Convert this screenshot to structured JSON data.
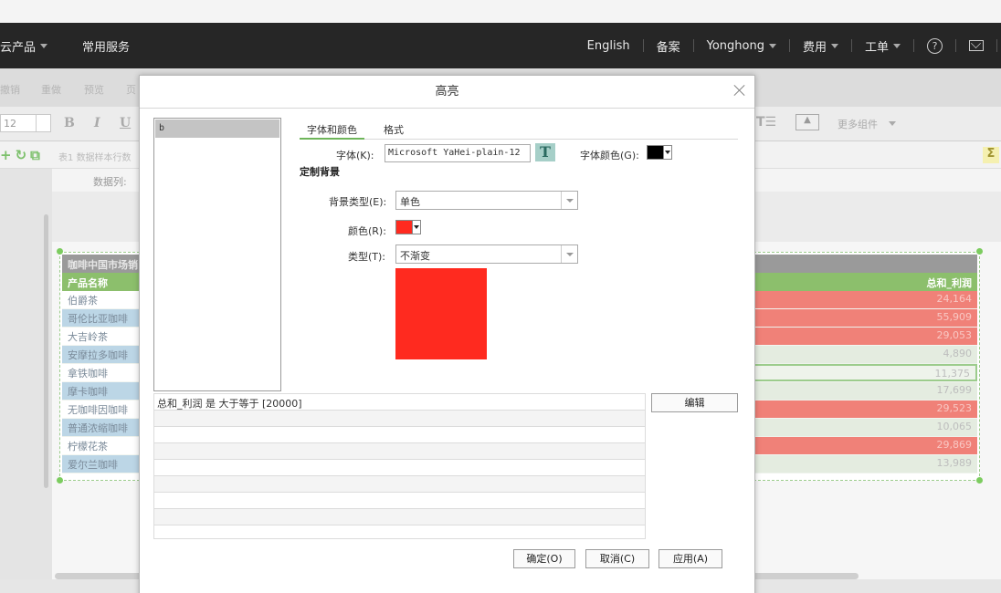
{
  "topnav": {
    "left_items": [
      "云产品",
      "常用服务"
    ],
    "right_items": [
      "English",
      "备案",
      "Yonghong",
      "费用",
      "工单"
    ],
    "help_icon": "question-circle-icon",
    "mail_icon": "mail-icon"
  },
  "editor": {
    "toolbar1": [
      "撤销",
      "重做",
      "预览",
      "页"
    ],
    "font_size": "12",
    "toolbar2_tools": [
      "B",
      "I",
      "U"
    ],
    "more_components": "更多组件",
    "sheet_label": "表1",
    "sheet_hint": "数据样本行数",
    "data_column_label": "数据列:",
    "sigma": "Σ"
  },
  "bg_table": {
    "title": "咖啡中国市场销",
    "col_name": "产品名称",
    "col_value": "总和_利润",
    "rows": [
      {
        "name": "伯爵茶",
        "value": "24,164",
        "hl": true
      },
      {
        "name": "哥伦比亚咖啡",
        "value": "55,909",
        "hl": true
      },
      {
        "name": "大吉岭茶",
        "value": "29,053",
        "hl": true
      },
      {
        "name": "安摩拉多咖啡",
        "value": "4,890",
        "hl": false
      },
      {
        "name": "拿铁咖啡",
        "value": "11,375",
        "hl": false
      },
      {
        "name": "摩卡咖啡",
        "value": "17,699",
        "hl": false
      },
      {
        "name": "无咖啡因咖啡",
        "value": "29,523",
        "hl": true
      },
      {
        "name": "普通浓缩咖啡",
        "value": "10,065",
        "hl": false
      },
      {
        "name": "柠檬花茶",
        "value": "29,869",
        "hl": true
      },
      {
        "name": "爱尔兰咖啡",
        "value": "13,989",
        "hl": false
      }
    ]
  },
  "dialog": {
    "title": "高亮",
    "rule_items": [
      "b"
    ],
    "tabs": [
      "字体和颜色",
      "格式"
    ],
    "font_label": "字体(K):",
    "font_value": "Microsoft YaHei-plain-12",
    "font_color_label": "字体颜色(G):",
    "font_color": "#000000",
    "custom_bg_title": "定制背景",
    "bg_type_label": "背景类型(E):",
    "bg_type_value": "单色",
    "color_label": "颜色(R):",
    "bg_color": "#ff2a1f",
    "type_label": "类型(T):",
    "type_value": "不渐变",
    "conditions": [
      "总和_利润 是 大于等于 [20000]"
    ],
    "edit_button": "编辑",
    "ok_button": "确定(O)",
    "cancel_button": "取消(C)",
    "apply_button": "应用(A)"
  }
}
